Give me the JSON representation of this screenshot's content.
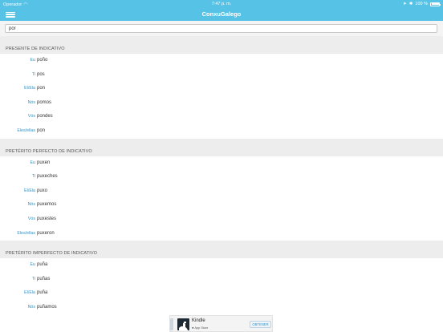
{
  "status_bar": {
    "carrier": "Operador",
    "time": "7:47 p. m.",
    "battery_text": "100 %"
  },
  "nav": {
    "title": "ConxuGalego"
  },
  "search": {
    "value": "pór"
  },
  "sections": [
    {
      "title": "PRESENTE DE INDICATIVO",
      "rows": [
        {
          "person": "Eu",
          "form": "poño"
        },
        {
          "person": "Ti",
          "form": "pos"
        },
        {
          "person": "El/Ela",
          "form": "pon"
        },
        {
          "person": "Nós",
          "form": "pomos"
        },
        {
          "person": "Vós",
          "form": "pondes"
        },
        {
          "person": "Eles/ellas",
          "form": "pon"
        }
      ]
    },
    {
      "title": "PRETÉRITO PERFECTO DE INDICATIVO",
      "rows": [
        {
          "person": "Eu",
          "form": "puxen"
        },
        {
          "person": "Ti",
          "form": "puxeches"
        },
        {
          "person": "El/Ela",
          "form": "puxo"
        },
        {
          "person": "Nós",
          "form": "puxemos"
        },
        {
          "person": "Vós",
          "form": "puxestes"
        },
        {
          "person": "Eles/ellas",
          "form": "puxeron"
        }
      ]
    },
    {
      "title": "PRETÉRITO IMPERFECTO DE INDICATIVO",
      "rows": [
        {
          "person": "Eu",
          "form": "puña"
        },
        {
          "person": "Ti",
          "form": "puñas"
        },
        {
          "person": "El/Ela",
          "form": "puña"
        },
        {
          "person": "Nós",
          "form": "puñamos"
        }
      ]
    }
  ],
  "ad": {
    "app_name": "Kindle",
    "store": "App Store",
    "button": "OBTENER"
  },
  "colors": {
    "accent": "#56c2e6",
    "person_label": "#2e94c9",
    "section_bg": "#ededed"
  }
}
